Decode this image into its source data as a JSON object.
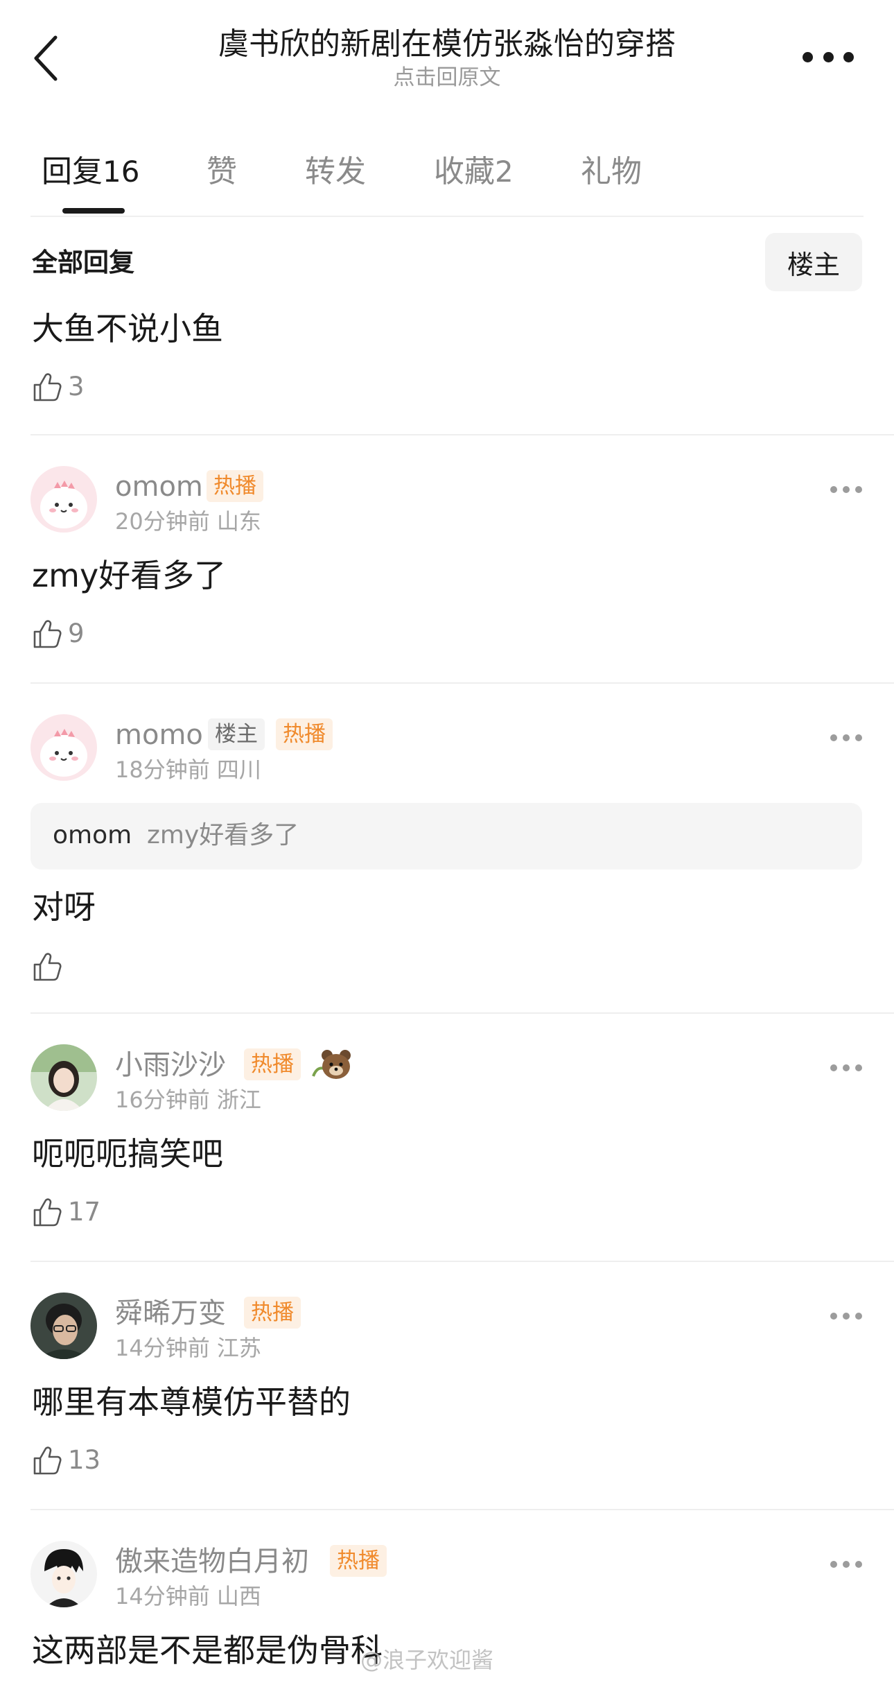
{
  "header": {
    "title": "虞书欣的新剧在模仿张淼怡的穿搭",
    "subtitle": "点击回原文"
  },
  "tabs": [
    {
      "label": "回复",
      "count": "16",
      "active": true
    },
    {
      "label": "赞",
      "count": ""
    },
    {
      "label": "转发",
      "count": ""
    },
    {
      "label": "收藏",
      "count": "2"
    },
    {
      "label": "礼物",
      "count": ""
    }
  ],
  "section": {
    "title": "全部回复",
    "filter_label": "楼主"
  },
  "post": {
    "text": "大鱼不说小鱼",
    "likes": "3"
  },
  "comments": [
    {
      "username": "omom",
      "badges": [
        "热播"
      ],
      "time": "20分钟前",
      "location": "山东",
      "text": "zmy好看多了",
      "likes": "9",
      "avatar": "pink-dino-avatar"
    },
    {
      "username": "momo",
      "badges": [
        "楼主",
        "热播"
      ],
      "time": "18分钟前",
      "location": "四川",
      "quote_user": "omom",
      "quote_text": "zmy好看多了",
      "text": "对呀",
      "likes": "",
      "avatar": "pink-dino-avatar"
    },
    {
      "username": "小雨沙沙",
      "badges": [
        "热播"
      ],
      "time": "16分钟前",
      "location": "浙江",
      "text": "呃呃呃搞笑吧",
      "likes": "17",
      "avatar": "girl-photo-avatar",
      "extra_icon": "bear-sticker-icon"
    },
    {
      "username": "舜晞万变",
      "badges": [
        "热播"
      ],
      "time": "14分钟前",
      "location": "江苏",
      "text": "哪里有本尊模仿平替的",
      "likes": "13",
      "avatar": "man-photo-avatar"
    },
    {
      "username": "傲来造物白月初",
      "badges": [
        "热播"
      ],
      "time": "14分钟前",
      "location": "山西",
      "text": "这两部是不是都是伪骨科",
      "likes": "",
      "avatar": "anime-avatar"
    }
  ],
  "watermark": "@浪子欢迎酱",
  "colors": {
    "accent_hot": "#f08a2c",
    "hot_bg": "#fdf0e3",
    "text_primary": "#1a1a1a",
    "text_secondary": "#8a8a8a"
  }
}
